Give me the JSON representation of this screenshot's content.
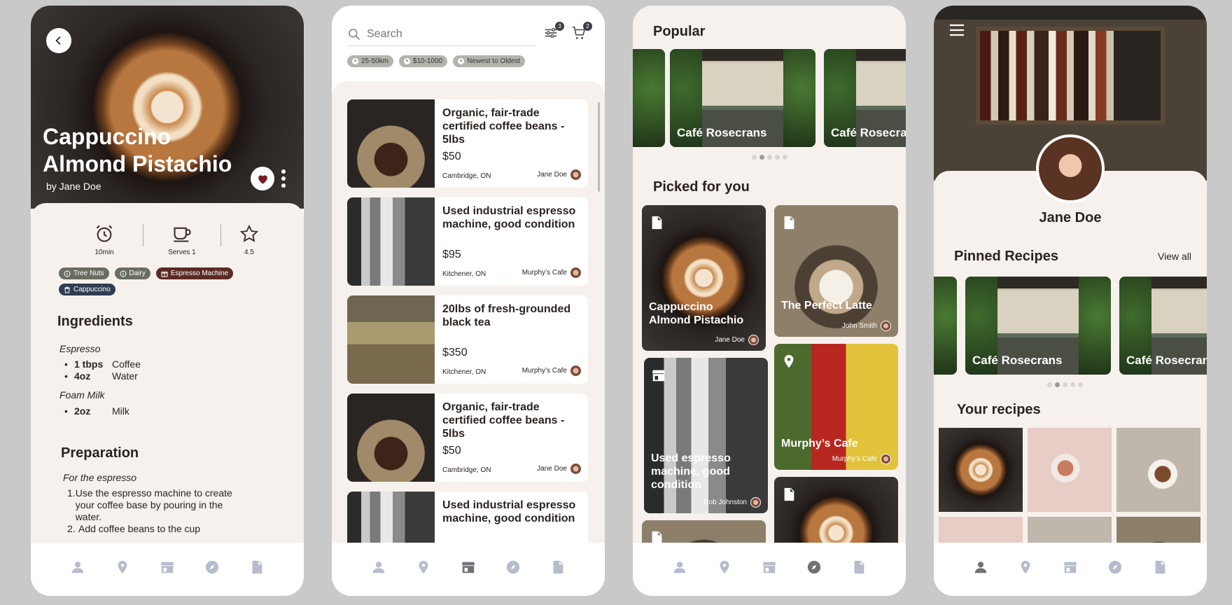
{
  "p1": {
    "title": "Cappuccino Almond Pistachio",
    "author": "by Jane Doe",
    "stats": [
      {
        "icon": "alarm-icon",
        "label": "10min"
      },
      {
        "icon": "cup-icon",
        "label": "Serves 1"
      },
      {
        "icon": "star-icon",
        "label": "4.5"
      }
    ],
    "tags": [
      {
        "icon": "info-icon",
        "label": "Tree Nuts",
        "color": "#6a6e61"
      },
      {
        "icon": "info-icon",
        "label": "Dairy",
        "color": "#6a6e61"
      },
      {
        "icon": "gift-icon",
        "label": "Espresso Machine",
        "color": "#5a2a22"
      },
      {
        "icon": "trash-icon",
        "label": "Cappuccino",
        "color": "#2f3e52"
      }
    ],
    "ingredients_title": "Ingredients",
    "groups": [
      {
        "name": "Espresso",
        "items": [
          {
            "qty": "1 tbps",
            "name": "Coffee"
          },
          {
            "qty": "4oz",
            "name": "Water"
          }
        ]
      },
      {
        "name": "Foam Milk",
        "items": [
          {
            "qty": "2oz",
            "name": "Milk"
          }
        ]
      }
    ],
    "prep_title": "Preparation",
    "prep_group": "For the espresso",
    "steps": [
      "Use the espresso machine to create your coffee base by pouring in the water.",
      "Add coffee beans to the cup"
    ]
  },
  "p2": {
    "search_placeholder": "Search",
    "filter_badge": "3",
    "cart_badge": "2",
    "filters": [
      "25-50km",
      "$10-1000",
      "Newest to Oldest"
    ],
    "listings": [
      {
        "title": "Organic, fair-trade certified coffee beans - 5lbs",
        "price": "$50",
        "location": "Cambridge, ON",
        "seller": "Jane Doe"
      },
      {
        "title": "Used industrial espresso machine, good condition",
        "price": "$95",
        "location": "Kitchener, ON",
        "seller": "Murphy’s Cafe"
      },
      {
        "title": "20lbs of fresh-grounded black tea",
        "price": "$350",
        "location": "Kitchener, ON",
        "seller": "Murphy’s Cafe"
      },
      {
        "title": "Organic, fair-trade certified coffee beans - 5lbs",
        "price": "$50",
        "location": "Cambridge, ON",
        "seller": "Jane Doe"
      },
      {
        "title": "Used industrial espresso machine, good condition",
        "price": "",
        "location": "",
        "seller": ""
      }
    ]
  },
  "p3": {
    "popular": "Popular",
    "cafe1": "Café Rosecrans",
    "cafe2": "Café Rosecrans",
    "picked": "Picked for you",
    "cards": [
      {
        "title": "Cappuccino Almond Pistachio",
        "by": "Jane Doe"
      },
      {
        "title": "The Perfect Latte",
        "by": "John Smith"
      },
      {
        "title": "Used espresso machine, good condition",
        "by": "Rob Johnston"
      },
      {
        "title": "Murphy’s Cafe",
        "by": "Murphy’s Cafe"
      }
    ]
  },
  "p4": {
    "name": "Jane Doe",
    "pinned": "Pinned Recipes",
    "view_all": "View all",
    "cafe1": "Café Rosecrans",
    "cafe2": "Café Rosecrans",
    "your_recipes": "Your recipes"
  }
}
